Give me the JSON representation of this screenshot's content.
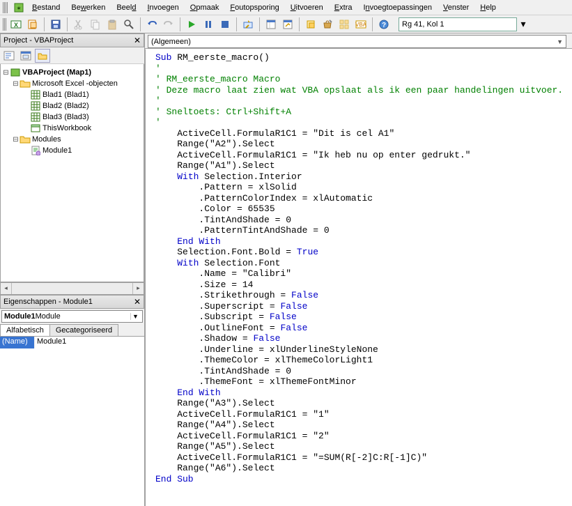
{
  "menu": {
    "items": [
      "Bestand",
      "Bewerken",
      "Beeld",
      "Invoegen",
      "Opmaak",
      "Foutopsporing",
      "Uitvoeren",
      "Extra",
      "Invoegtoepassingen",
      "Venster",
      "Help"
    ]
  },
  "toolbar": {
    "position": "Rg 41, Kol 1"
  },
  "project_panel": {
    "title": "Project - VBAProject",
    "root": "VBAProject (Map1)",
    "excel_group": "Microsoft Excel -objecten",
    "sheets": [
      "Blad1 (Blad1)",
      "Blad2 (Blad2)",
      "Blad3 (Blad3)"
    ],
    "workbook": "ThisWorkbook",
    "modules_group": "Modules",
    "module": "Module1"
  },
  "properties_panel": {
    "title": "Eigenschappen - Module1",
    "combo_bold": "Module1",
    "combo_rest": " Module",
    "tab_alpha": "Alfabetisch",
    "tab_cat": "Gecategoriseerd",
    "prop_name_label": "(Name)",
    "prop_name_value": "Module1"
  },
  "code": {
    "combo_left": "(Algemeen)",
    "combo_right": "",
    "sub_name": "RM_eerste_macro",
    "comments": {
      "c1": "' RM_eerste_macro Macro",
      "c2": "' Deze macro laat zien wat VBA opslaat als ik een paar handelingen uitvoer.",
      "c3": "' Sneltoets: Ctrl+Shift+A"
    },
    "strings": {
      "s1": "\"Dit is cel A1\"",
      "s2": "\"A2\"",
      "s3": "\"Ik heb nu op enter gedrukt.\"",
      "s4": "\"A1\"",
      "s5": "\"Calibri\"",
      "s6": "\"A3\"",
      "s7": "\"1\"",
      "s8": "\"A4\"",
      "s9": "\"2\"",
      "s10": "\"A5\"",
      "s11": "\"=SUM(R[-2]C:R[-1]C)\"",
      "s12": "\"A6\""
    }
  }
}
